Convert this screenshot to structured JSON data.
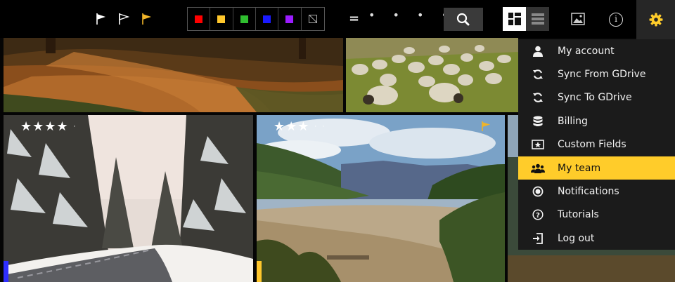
{
  "toolbar": {
    "flags": [
      {
        "name": "flag-white-filled-icon",
        "color": "#ffffff"
      },
      {
        "name": "flag-white-outline-icon",
        "color": "#ffffff"
      },
      {
        "name": "flag-yellow-icon",
        "color": "#f0b429"
      }
    ],
    "color_filters": [
      {
        "name": "red",
        "color": "#ff0000"
      },
      {
        "name": "yellow",
        "color": "#ffc72c"
      },
      {
        "name": "green",
        "color": "#2fbe2f"
      },
      {
        "name": "blue",
        "color": "#1a1aff"
      },
      {
        "name": "purple",
        "color": "#9b1cff"
      },
      {
        "name": "none",
        "color": ""
      }
    ],
    "rating_operator": "=",
    "rating_dots": "• • • • •",
    "accent_color": "#ffcc2a"
  },
  "tiles": [
    {
      "id": "forest-path",
      "rating": 0,
      "rating_stars": "",
      "rating_empty": "",
      "color_tag": ""
    },
    {
      "id": "sheep",
      "rating": 0,
      "rating_stars": "",
      "rating_empty": "",
      "color_tag": ""
    },
    {
      "id": "snowy-road",
      "rating": 4,
      "rating_stars": "★★★★",
      "rating_empty": "·",
      "color_tag": "#2f2fff"
    },
    {
      "id": "lake-valley",
      "rating": 3,
      "rating_stars": "★★★",
      "rating_empty": "··",
      "color_tag": "#ffc72c",
      "flagged": true
    }
  ],
  "menu": {
    "items": [
      {
        "label": "My account",
        "icon": "user-icon"
      },
      {
        "label": "Sync From GDrive",
        "icon": "sync-icon"
      },
      {
        "label": "Sync To GDrive",
        "icon": "sync-icon"
      },
      {
        "label": "Billing",
        "icon": "database-icon"
      },
      {
        "label": "Custom Fields",
        "icon": "star-box-icon"
      },
      {
        "label": "My team",
        "icon": "team-icon",
        "active": true
      },
      {
        "label": "Notifications",
        "icon": "record-icon"
      },
      {
        "label": "Tutorials",
        "icon": "help-icon"
      },
      {
        "label": "Log out",
        "icon": "logout-icon"
      }
    ]
  }
}
